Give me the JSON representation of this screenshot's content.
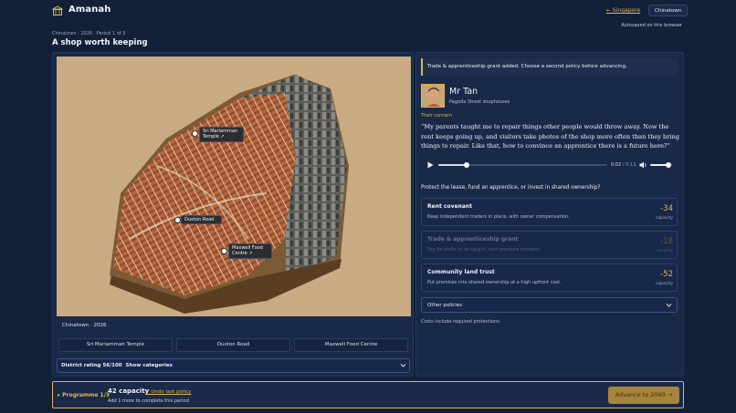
{
  "app": {
    "name": "Amanah",
    "back_link": "← Singapore",
    "location_chip": "Chinatown",
    "autosave": "Autosaved on this browser"
  },
  "page": {
    "breadcrumb": "Chinatown · 2026 · Period 1 of 3",
    "title": "A shop worth keeping"
  },
  "map": {
    "caption": "Chinatown · 2026",
    "pins": [
      {
        "label": "Sri Mariamman\nTemple ↗"
      },
      {
        "label": "Duxton Road ↗"
      },
      {
        "label": "Maxwell Food\nCentre ↗"
      }
    ],
    "places": [
      "Sri Mariamman Temple",
      "Duxton Road",
      "Maxwell Food Centre"
    ],
    "rating_label": "District rating",
    "rating_value": "56/100",
    "rating_action": "Show categories"
  },
  "banner": "Trade & apprenticeship grant added. Choose a second policy before advancing.",
  "person": {
    "name": "Mr Tan",
    "place": "Pagoda Street shophouses",
    "concern_label": "Their concern",
    "quote": "“My parents taught me to repair things other people would throw away. Now the rent keeps going up, and visitors take photos of the shop more often than they bring things to repair. Like that, how to convince an apprentice there is a future here?”"
  },
  "audio": {
    "current": "0:02",
    "separator": "/",
    "total": "0:13",
    "progress": 0.17,
    "volume": 0.85
  },
  "question": "Protect the lease, fund an apprentice, or invest in shared ownership?",
  "policies": [
    {
      "title": "Rent covenant",
      "desc": "Keep independent traders in place, with owner compensation.",
      "cost": "-34",
      "unit": "capacity",
      "disabled": false
    },
    {
      "title": "Trade & apprenticeship grant",
      "desc": "Pay for skills to be taught; rent pressure remains.",
      "cost": "-18",
      "unit": "capacity",
      "disabled": true
    },
    {
      "title": "Community land trust",
      "desc": "Put premises into shared ownership at a high upfront cost.",
      "cost": "-52",
      "unit": "capacity",
      "disabled": false
    }
  ],
  "other_policies": "Other policies",
  "costs_note": "Costs include required protections.",
  "footer": {
    "programme": "▸ Programme 1/3",
    "capacity": "42 capacity",
    "undo": "↶ Undo last policy",
    "note": "Add 1 more to complete this period",
    "advance": "Advance to 2060 →"
  },
  "colors": {
    "accent": "#e0b64a",
    "background": "#13203a",
    "panel": "#192a48"
  }
}
